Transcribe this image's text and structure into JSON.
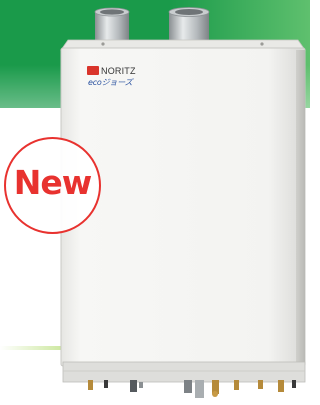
{
  "badge": {
    "text": "New"
  },
  "product": {
    "brand_name": "NORITZ",
    "eco_logo_text": "ecoジョーズ"
  },
  "colors": {
    "band_green": "#1a9a4a",
    "band_green_light": "#5fc06e",
    "badge_red": "#e8322f",
    "accent_line": "#b9df7a",
    "brand_red": "#d9342b",
    "unit_white": "#f5f5f3"
  }
}
